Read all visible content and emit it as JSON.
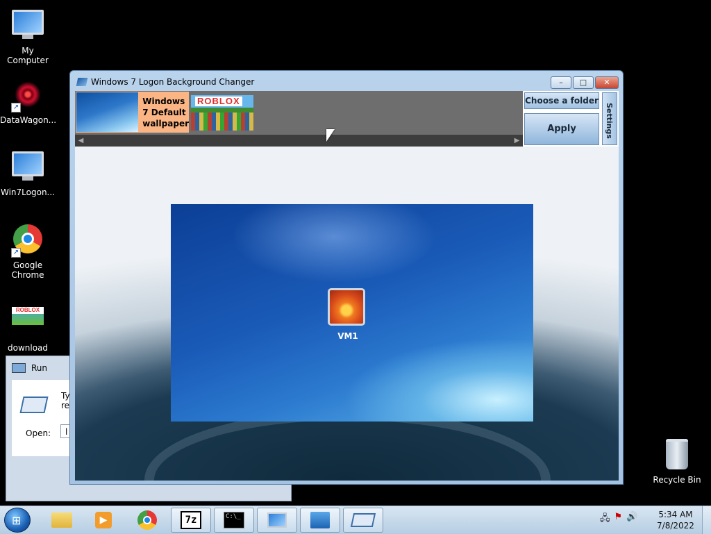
{
  "desktop": {
    "icons": [
      {
        "label": "My Computer",
        "icon": "computer-icon"
      },
      {
        "label": "DataWagon...",
        "icon": "datawagon-icon"
      },
      {
        "label": "Win7Logon...",
        "icon": "monitor-icon"
      },
      {
        "label": "Google Chrome",
        "icon": "chrome-icon"
      },
      {
        "label": "download",
        "icon": "roblox-image-icon"
      },
      {
        "label": "Recycle Bin",
        "icon": "recycle-bin-icon"
      }
    ]
  },
  "run_dialog": {
    "title": "Run",
    "description": "Typ\nreso",
    "open_label": "Open:",
    "open_value": "l"
  },
  "window": {
    "title": "Windows 7 Logon Background Changer",
    "minimize": "–",
    "maximize": "□",
    "close": "✕",
    "thumbnails": [
      {
        "label": "Windows 7 Default wallpaper",
        "selected": true
      },
      {
        "label": "ROBLOX",
        "selected": false
      }
    ],
    "choose_folder_label": "Choose a folder",
    "apply_label": "Apply",
    "settings_label": "Settings",
    "scroll_left": "◀",
    "scroll_right": "▶",
    "preview": {
      "username": "VM1"
    }
  },
  "taskbar": {
    "start_glyph": "⊞",
    "items": [
      {
        "name": "explorer",
        "running": false
      },
      {
        "name": "media-player",
        "running": false
      },
      {
        "name": "chrome",
        "running": false
      },
      {
        "name": "7zip",
        "label": "7z",
        "running": true
      },
      {
        "name": "cmd",
        "label": "C:\\_",
        "running": true
      },
      {
        "name": "logon-changer",
        "running": true
      },
      {
        "name": "control-panel",
        "running": true
      },
      {
        "name": "run",
        "running": true
      }
    ],
    "clock_time": "5:34 AM",
    "clock_date": "7/8/2022"
  }
}
